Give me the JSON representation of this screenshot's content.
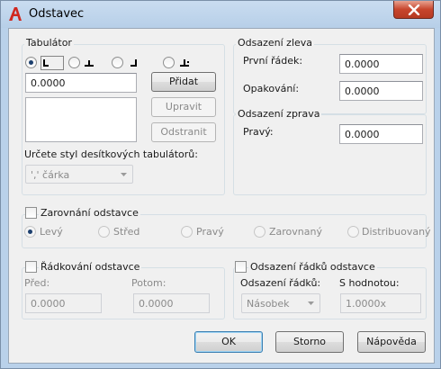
{
  "window": {
    "title": "Odstavec"
  },
  "icons": {
    "app": "autocad-a-logo-icon",
    "close": "close-x-icon",
    "tabs": [
      "left-tab-icon",
      "center-tab-icon",
      "right-tab-icon",
      "decimal-tab-icon"
    ]
  },
  "colors": {
    "close_button": "#c7452c",
    "app_logo": "#d0281f",
    "titlebar": "#b9d1ea"
  },
  "tab_group": {
    "title": "Tabulátor",
    "selected_index": 0,
    "value": "0.0000",
    "add_button": "Přidat",
    "modify_button": "Upravit",
    "remove_button": "Odstranit",
    "decimal_style_label": "Určete styl desítkových tabulátorů:",
    "decimal_style_value": "',' čárka"
  },
  "left_indent": {
    "title": "Odsazení zleva",
    "first_line_label": "První řádek:",
    "first_line_value": "0.0000",
    "hanging_label": "Opakování:",
    "hanging_value": "0.0000"
  },
  "right_indent": {
    "title": "Odsazení zprava",
    "right_label": "Pravý:",
    "right_value": "0.0000"
  },
  "alignment": {
    "title": "Zarovnání odstavce",
    "checked": false,
    "options": [
      "Levý",
      "Střed",
      "Pravý",
      "Zarovnaný",
      "Distribuovaný"
    ],
    "selected_index": 0
  },
  "spacing": {
    "title": "Řádkování odstavce",
    "checked": false,
    "before_label": "Před:",
    "before_value": "0.0000",
    "after_label": "Potom:",
    "after_value": "0.0000"
  },
  "line_spacing": {
    "title": "Odsazení řádků odstavce",
    "checked": false,
    "type_label": "Odsazení řádků:",
    "type_value": "Násobek",
    "value_label": "S hodnotou:",
    "value_value": "1.0000x"
  },
  "buttons": {
    "ok": "OK",
    "cancel": "Storno",
    "help": "Nápověda"
  }
}
